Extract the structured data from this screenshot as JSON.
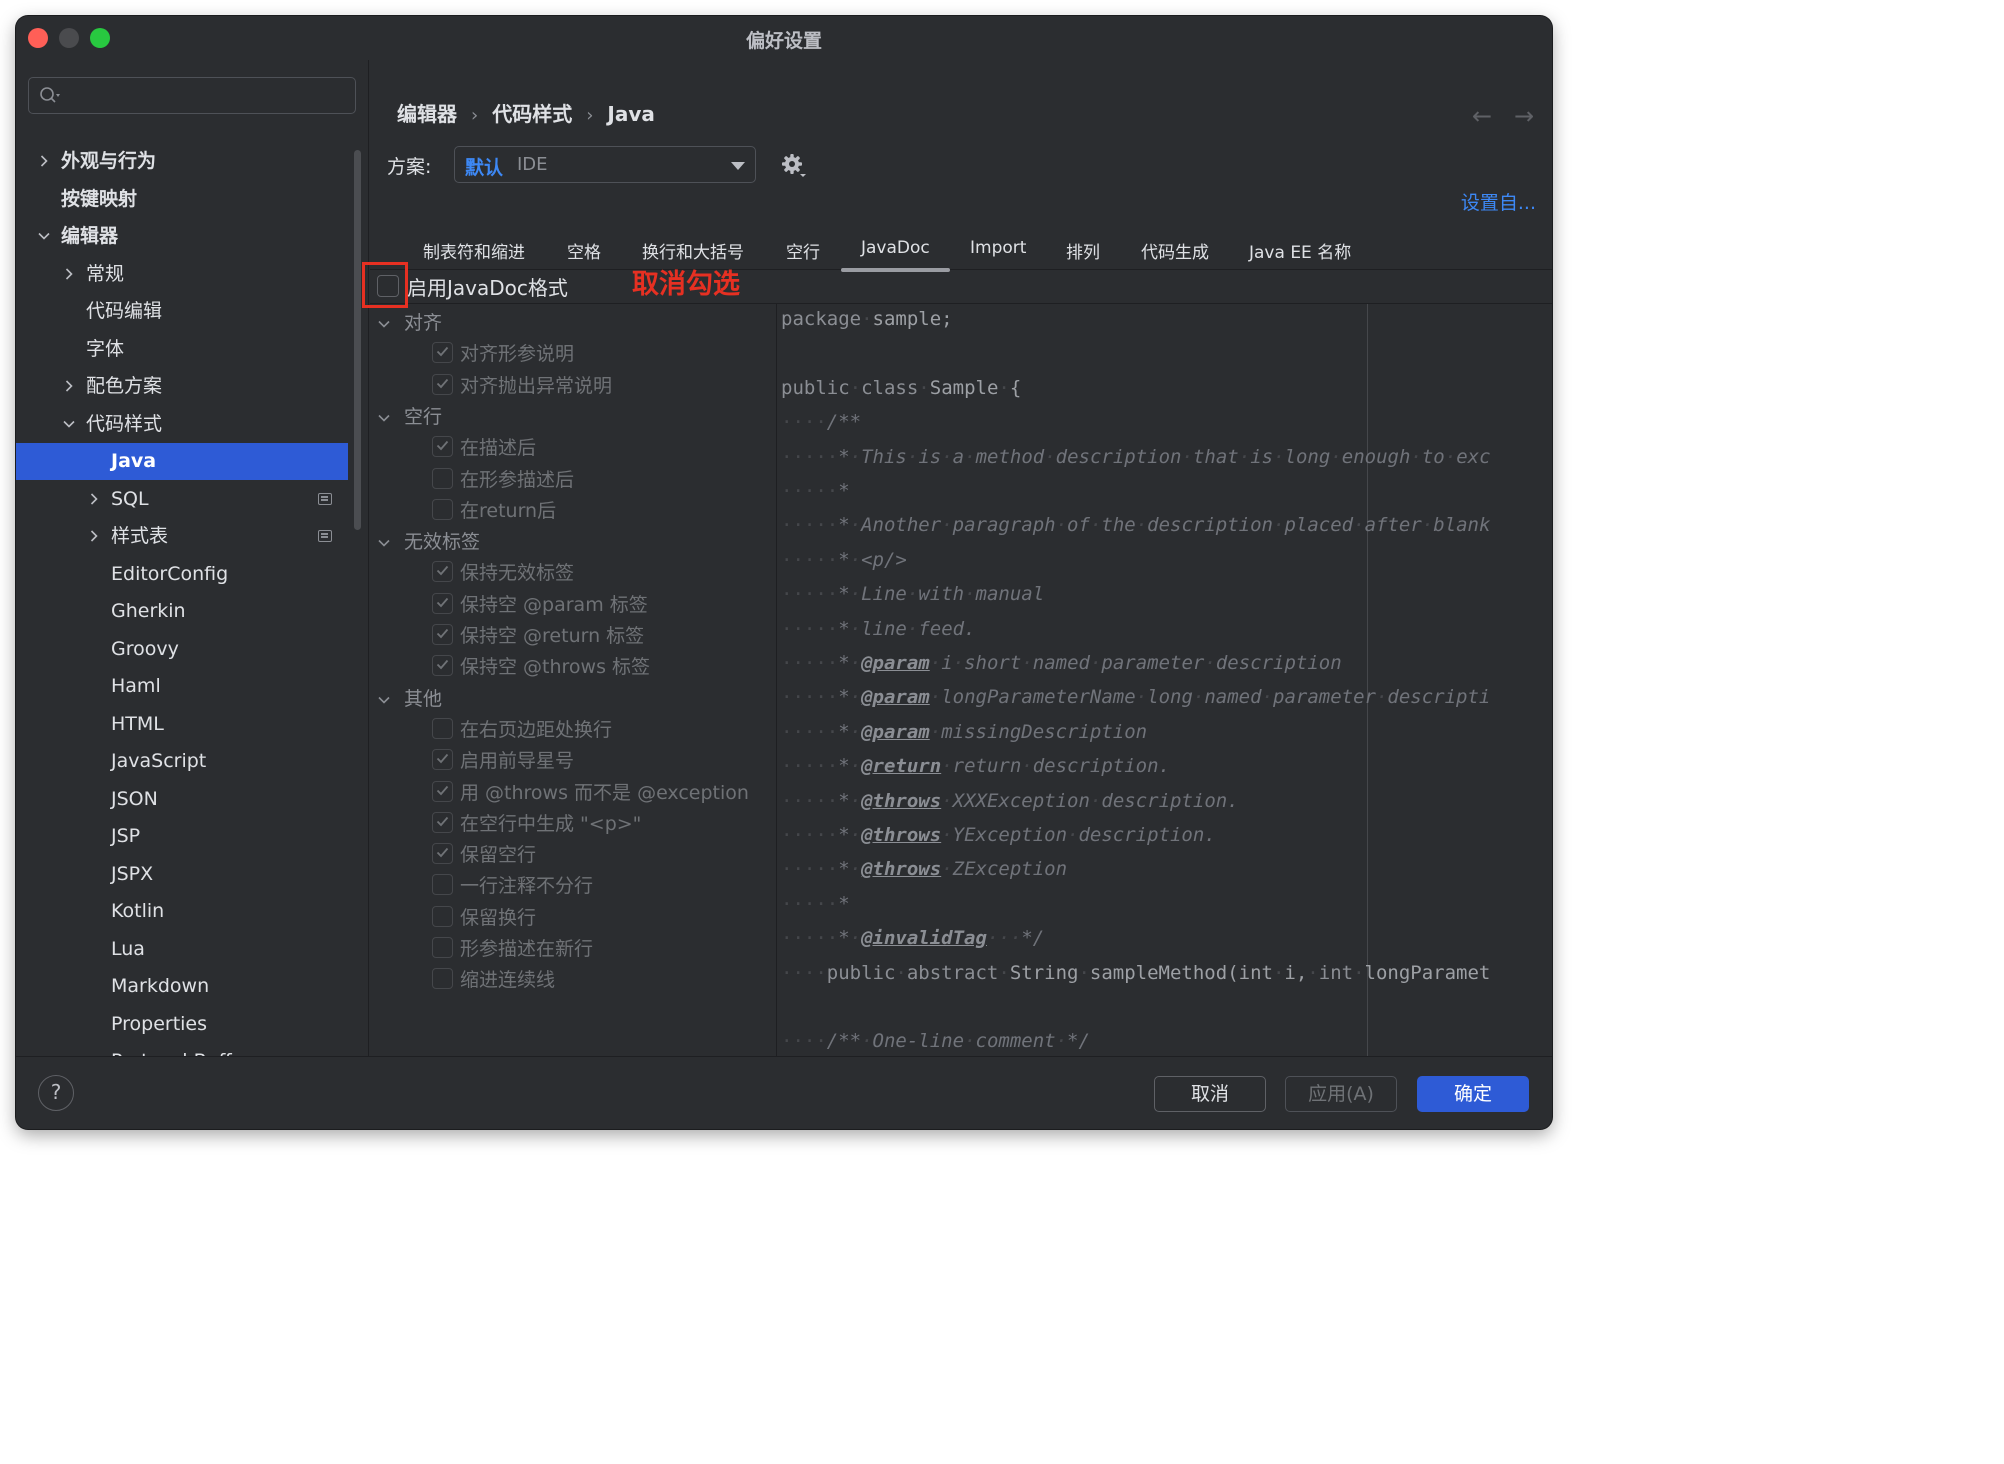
{
  "window": {
    "title": "偏好设置"
  },
  "search": {
    "placeholder": "",
    "value": ""
  },
  "sidebar": {
    "items": [
      {
        "label": "外观与行为",
        "bold": true
      },
      {
        "label": "按键映射",
        "bold": true
      },
      {
        "label": "编辑器",
        "bold": true
      },
      {
        "label": "常规"
      },
      {
        "label": "代码编辑"
      },
      {
        "label": "字体"
      },
      {
        "label": "配色方案"
      },
      {
        "label": "代码样式"
      },
      {
        "label": "Java"
      },
      {
        "label": "SQL"
      },
      {
        "label": "样式表"
      },
      {
        "label": "EditorConfig"
      },
      {
        "label": "Gherkin"
      },
      {
        "label": "Groovy"
      },
      {
        "label": "Haml"
      },
      {
        "label": "HTML"
      },
      {
        "label": "JavaScript"
      },
      {
        "label": "JSON"
      },
      {
        "label": "JSP"
      },
      {
        "label": "JSPX"
      },
      {
        "label": "Kotlin"
      },
      {
        "label": "Lua"
      },
      {
        "label": "Markdown"
      },
      {
        "label": "Properties"
      },
      {
        "label": "Protocol Buffer"
      }
    ]
  },
  "breadcrumb": {
    "items": [
      "编辑器",
      "代码样式",
      "Java"
    ],
    "separator": "›"
  },
  "nav": {
    "back": "←",
    "forward": "→"
  },
  "scheme": {
    "label": "方案:",
    "name": "默认",
    "kind": "IDE"
  },
  "settings_link": "设置自...",
  "tabs": [
    "制表符和缩进",
    "空格",
    "换行和大括号",
    "空行",
    "JavaDoc",
    "Import",
    "排列",
    "代码生成",
    "Java EE 名称"
  ],
  "active_tab": "JavaDoc",
  "enable_javadoc": {
    "label": "启用JavaDoc格式",
    "checked": false
  },
  "annotation": "取消勾选",
  "groups": [
    {
      "title": "对齐",
      "options": [
        {
          "label": "对齐形参说明",
          "checked": true
        },
        {
          "label": "对齐抛出异常说明",
          "checked": true
        }
      ]
    },
    {
      "title": "空行",
      "options": [
        {
          "label": "在描述后",
          "checked": true
        },
        {
          "label": "在形参描述后",
          "checked": false
        },
        {
          "label": "在return后",
          "checked": false
        }
      ]
    },
    {
      "title": "无效标签",
      "options": [
        {
          "label": "保持无效标签",
          "checked": true
        },
        {
          "label": "保持空 @param 标签",
          "checked": true
        },
        {
          "label": "保持空 @return 标签",
          "checked": true
        },
        {
          "label": "保持空 @throws 标签",
          "checked": true
        }
      ]
    },
    {
      "title": "其他",
      "options": [
        {
          "label": "在右页边距处换行",
          "checked": false
        },
        {
          "label": "启用前导星号",
          "checked": true
        },
        {
          "label": "用 @throws 而不是 @exception",
          "checked": true
        },
        {
          "label": "在空行中生成 \"<p>\"",
          "checked": true
        },
        {
          "label": "保留空行",
          "checked": true
        },
        {
          "label": "一行注释不分行",
          "checked": false
        },
        {
          "label": "保留换行",
          "checked": false
        },
        {
          "label": "形参描述在新行",
          "checked": false
        },
        {
          "label": "缩进连续线",
          "checked": false
        }
      ]
    }
  ],
  "preview": {
    "lines": [
      "package sample;",
      "",
      "public class Sample {",
      "    /**",
      "     * This is a method description that is long enough to exc",
      "     *",
      "     * Another paragraph of the description placed after blank",
      "     * <p/>",
      "     * Line with manual",
      "     * line feed.",
      "     * @param i short named parameter description",
      "     * @param longParameterName long named parameter descripti",
      "     * @param missingDescription",
      "     * @return return description.",
      "     * @throws XXXException description.",
      "     * @throws YException description.",
      "     * @throws ZException",
      "     *",
      "     * @invalidTag   */",
      "    public abstract String sampleMethod(int i, int longParamet",
      "",
      "    /** One-line comment */"
    ]
  },
  "footer": {
    "help": "?",
    "cancel": "取消",
    "apply": "应用(A)",
    "ok": "确定"
  }
}
